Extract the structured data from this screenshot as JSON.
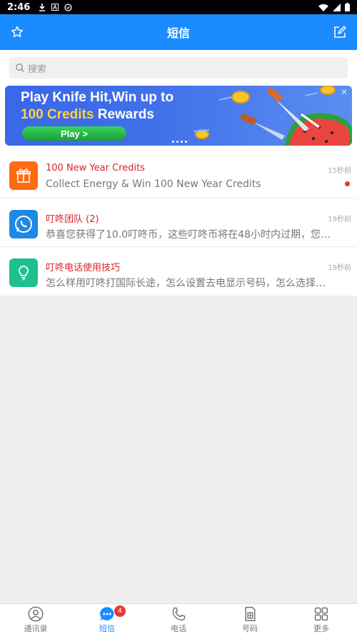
{
  "status_bar": {
    "time": "2:46"
  },
  "header": {
    "title": "短信",
    "left_icon": "star-icon",
    "right_icon": "compose-icon"
  },
  "search": {
    "placeholder": "搜索"
  },
  "banner": {
    "line1": "Play Knife Hit,Win up to",
    "line2_highlight": "100 Credits",
    "line2_rest": " Rewards",
    "cta": "Play >",
    "close": "✕"
  },
  "messages": [
    {
      "name": "100 New Year Credits",
      "preview": "Collect Energy & Win 100 New Year Credits",
      "time": "15秒前",
      "unread": true,
      "icon": "gift-icon",
      "color": "#ff6a13"
    },
    {
      "name": "叮咚团队 (2)",
      "preview": "恭喜您获得了10.0叮咚币，这些叮咚币将在48小时内过期，您…",
      "time": "19秒前",
      "unread": false,
      "icon": "phone-bubble-icon",
      "color": "#1e88e5"
    },
    {
      "name": "叮咚电话使用技巧",
      "preview": "怎么样用叮咚打国际长途，怎么设置去电显示号码，怎么选择…",
      "time": "19秒前",
      "unread": false,
      "icon": "lightbulb-icon",
      "color": "#1fbf8f"
    }
  ],
  "tabs": [
    {
      "label": "通讯录",
      "icon": "contacts-icon"
    },
    {
      "label": "短信",
      "icon": "sms-icon",
      "badge": "4",
      "active": true
    },
    {
      "label": "电话",
      "icon": "phone-icon"
    },
    {
      "label": "号码",
      "icon": "sim-card-icon"
    },
    {
      "label": "更多",
      "icon": "grid-icon"
    }
  ],
  "colors": {
    "primary": "#1a8cff",
    "accent_red": "#d9262a"
  }
}
